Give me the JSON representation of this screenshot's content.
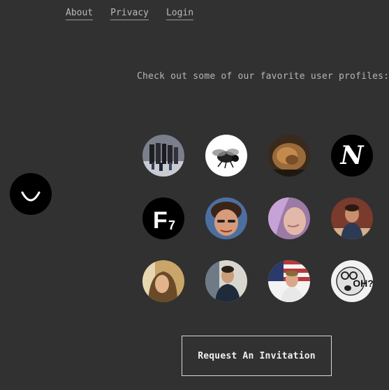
{
  "nav": {
    "items": [
      {
        "label": "About"
      },
      {
        "label": "Privacy"
      },
      {
        "label": "Login"
      }
    ]
  },
  "tagline": "Check out some of our favorite user profiles:",
  "logo": {
    "icon": "smiley-logo-icon"
  },
  "profiles": [
    {
      "name": "profile-group-photo",
      "badge_text": ""
    },
    {
      "name": "profile-fly",
      "badge_text": ""
    },
    {
      "name": "profile-wood",
      "badge_text": ""
    },
    {
      "name": "profile-n-logo",
      "badge_text": "N"
    },
    {
      "name": "profile-f7-logo",
      "badge_text": "F",
      "badge_sub": "7"
    },
    {
      "name": "profile-man-selfie",
      "badge_text": ""
    },
    {
      "name": "profile-purple-hair",
      "badge_text": ""
    },
    {
      "name": "profile-man-cafe",
      "badge_text": ""
    },
    {
      "name": "profile-woman-portrait",
      "badge_text": ""
    },
    {
      "name": "profile-man-seated",
      "badge_text": ""
    },
    {
      "name": "profile-man-flag",
      "badge_text": ""
    },
    {
      "name": "profile-oh-illustration",
      "badge_text": "OH?"
    }
  ],
  "cta": {
    "label": "Request An Invitation"
  },
  "colors": {
    "background": "#313131",
    "nav_text": "#b9b9b9",
    "button_border": "#d8d8d8"
  }
}
